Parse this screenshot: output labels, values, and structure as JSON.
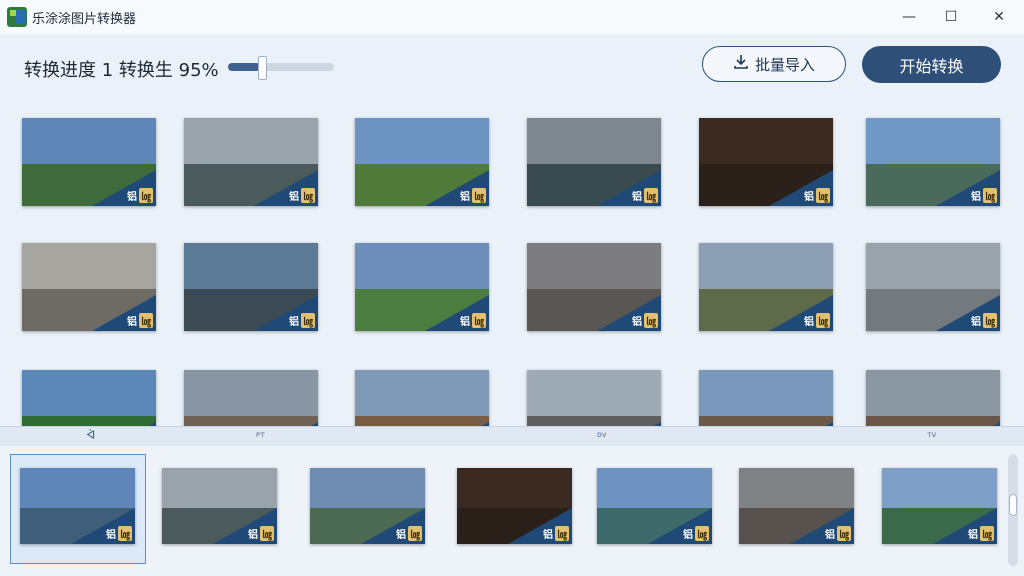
{
  "app": {
    "title": "乐涂涂图片转换器"
  },
  "window_controls": {
    "minimize": "—",
    "maximize": "☐",
    "close": "✕"
  },
  "top": {
    "progress_text": "转换进度 1 转换生 95%",
    "progress_value": 0.95,
    "import_label": "批量导入",
    "start_label": "开始转换"
  },
  "divider": {
    "a": "ᢱ",
    "b": "ᴘᴛ",
    "c": "ᴅᴠ",
    "d": "ᴛᴠ"
  },
  "colors": {
    "accent": "#2d4f78",
    "bg": "#eaf1f9"
  },
  "grid": [
    {
      "sky": "#5e86b8",
      "ground": "#3f6a3c"
    },
    {
      "sky": "#9aa3ab",
      "ground": "#4b5a5b"
    },
    {
      "sky": "#6d93c2",
      "ground": "#4f7a3a"
    },
    {
      "sky": "#7e8790",
      "ground": "#3a4b4f"
    },
    {
      "sky": "#3b2a20",
      "ground": "#2b211a"
    },
    {
      "sky": "#6f98c6",
      "ground": "#4a6a5b"
    },
    {
      "sky": "#a7a59f",
      "ground": "#6e6b65"
    },
    {
      "sky": "#5c7996",
      "ground": "#3b4a53"
    },
    {
      "sky": "#6e8fbb",
      "ground": "#4a7d3f"
    },
    {
      "sky": "#7d7d7f",
      "ground": "#5a5653"
    },
    {
      "sky": "#8c9fb4",
      "ground": "#5f6a4a"
    },
    {
      "sky": "#9aa2aa",
      "ground": "#73797d"
    },
    {
      "sky": "#5c88b9",
      "ground": "#2f6b35"
    },
    {
      "sky": "#8896a4",
      "ground": "#6d6254"
    },
    {
      "sky": "#7f99b6",
      "ground": "#7a5c45"
    },
    {
      "sky": "#9eaab6",
      "ground": "#5f5f5f"
    },
    {
      "sky": "#7a98bc",
      "ground": "#6b5a47"
    },
    {
      "sky": "#8a96a2",
      "ground": "#6a5546"
    }
  ],
  "strip": [
    {
      "sky": "#5f86b8",
      "ground": "#3f5e7a"
    },
    {
      "sky": "#9aa3ab",
      "ground": "#4b5a5b"
    },
    {
      "sky": "#6f8db2",
      "ground": "#4d6a55"
    },
    {
      "sky": "#3a2a21",
      "ground": "#2a2019"
    },
    {
      "sky": "#6f93c0",
      "ground": "#3e6a6c"
    },
    {
      "sky": "#808285",
      "ground": "#58524e"
    },
    {
      "sky": "#7ea0c6",
      "ground": "#3b6a4a"
    }
  ],
  "tag": {
    "a": "铝",
    "b": "㏒"
  }
}
